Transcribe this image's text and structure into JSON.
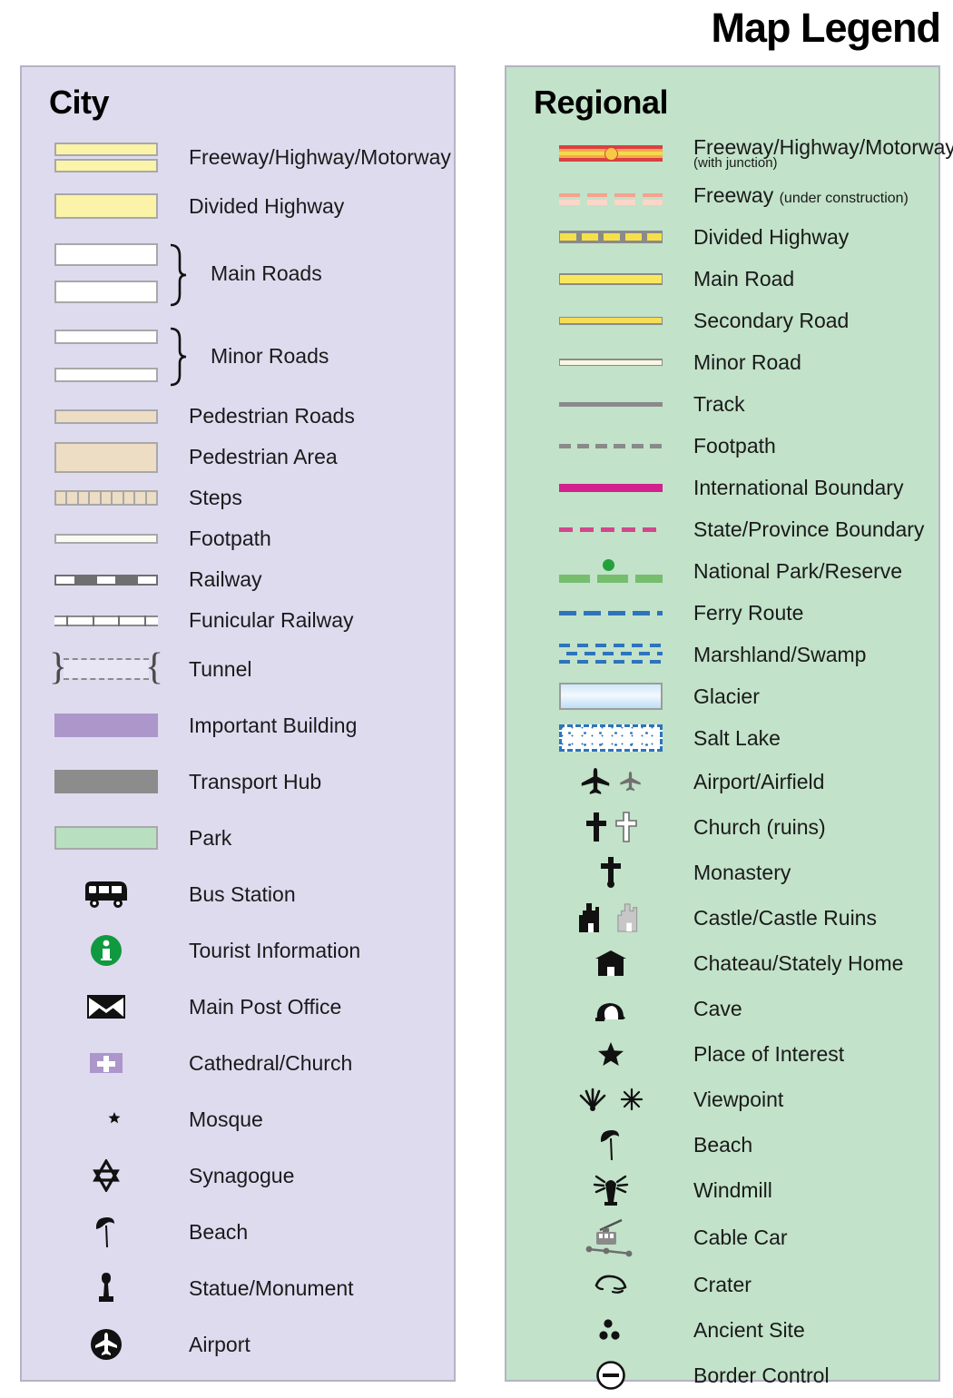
{
  "title": "Map Legend",
  "city": {
    "heading": "City",
    "bg_color": "#dedbef",
    "items": [
      {
        "symbol": "city-freeway-swatch",
        "label": "Freeway/Highway/Motorway"
      },
      {
        "symbol": "city-divided-highway-swatch",
        "label": "Divided Highway"
      },
      {
        "symbol": "city-main-roads-swatch",
        "label": "Main Roads"
      },
      {
        "symbol": "city-minor-roads-swatch",
        "label": "Minor Roads"
      },
      {
        "symbol": "city-pedestrian-road-swatch",
        "label": "Pedestrian Roads"
      },
      {
        "symbol": "city-pedestrian-area-swatch",
        "label": "Pedestrian Area"
      },
      {
        "symbol": "city-steps-swatch",
        "label": "Steps"
      },
      {
        "symbol": "city-footpath-swatch",
        "label": "Footpath"
      },
      {
        "symbol": "city-railway-swatch",
        "label": "Railway"
      },
      {
        "symbol": "city-funicular-swatch",
        "label": "Funicular Railway"
      },
      {
        "symbol": "city-tunnel-swatch",
        "label": "Tunnel"
      },
      {
        "symbol": "city-important-building-swatch",
        "label": "Important Building"
      },
      {
        "symbol": "city-transport-hub-swatch",
        "label": "Transport Hub"
      },
      {
        "symbol": "city-park-swatch",
        "label": "Park"
      },
      {
        "symbol": "bus-icon",
        "label": "Bus Station"
      },
      {
        "symbol": "information-icon",
        "label": "Tourist Information"
      },
      {
        "symbol": "envelope-icon",
        "label": "Main Post Office"
      },
      {
        "symbol": "church-cross-icon",
        "label": "Cathedral/Church"
      },
      {
        "symbol": "crescent-star-icon",
        "label": "Mosque"
      },
      {
        "symbol": "star-of-david-icon",
        "label": "Synagogue"
      },
      {
        "symbol": "beach-umbrella-icon",
        "label": "Beach"
      },
      {
        "symbol": "statue-icon",
        "label": "Statue/Monument"
      },
      {
        "symbol": "airplane-circle-icon",
        "label": "Airport"
      }
    ]
  },
  "regional": {
    "heading": "Regional",
    "bg_color": "#c2e2c9",
    "items": [
      {
        "symbol": "regional-freeway-line",
        "label": "Freeway/Highway/Motorway",
        "sub_line": "(with junction)"
      },
      {
        "symbol": "regional-freeway-uc-line",
        "label": "Freeway ",
        "sub": "(under construction)"
      },
      {
        "symbol": "regional-divided-highway-line",
        "label": "Divided Highway"
      },
      {
        "symbol": "regional-main-road-line",
        "label": "Main Road"
      },
      {
        "symbol": "regional-secondary-road-line",
        "label": "Secondary Road"
      },
      {
        "symbol": "regional-minor-road-line",
        "label": "Minor Road"
      },
      {
        "symbol": "regional-track-line",
        "label": "Track"
      },
      {
        "symbol": "regional-footpath-line",
        "label": "Footpath"
      },
      {
        "symbol": "international-boundary-line",
        "label": "International Boundary"
      },
      {
        "symbol": "state-boundary-line",
        "label": "State/Province Boundary"
      },
      {
        "symbol": "national-park-line",
        "label": "National Park/Reserve"
      },
      {
        "symbol": "ferry-route-line",
        "label": "Ferry Route"
      },
      {
        "symbol": "marshland-swatch",
        "label": "Marshland/Swamp"
      },
      {
        "symbol": "glacier-swatch",
        "label": "Glacier"
      },
      {
        "symbol": "salt-lake-swatch",
        "label": "Salt Lake"
      },
      {
        "symbol": "airplane-pair-icon",
        "label": "Airport/Airfield"
      },
      {
        "symbol": "cross-pair-icon",
        "label": "Church (ruins)"
      },
      {
        "symbol": "monastery-cross-icon",
        "label": "Monastery"
      },
      {
        "symbol": "castle-pair-icon",
        "label": "Castle/Castle Ruins"
      },
      {
        "symbol": "chateau-icon",
        "label": "Chateau/Stately Home"
      },
      {
        "symbol": "cave-icon",
        "label": "Cave"
      },
      {
        "symbol": "star-icon",
        "label": "Place of Interest"
      },
      {
        "symbol": "viewpoint-pair-icon",
        "label": "Viewpoint"
      },
      {
        "symbol": "beach-umbrella-icon",
        "label": "Beach"
      },
      {
        "symbol": "windmill-icon",
        "label": "Windmill"
      },
      {
        "symbol": "cable-car-icon",
        "label": "Cable Car"
      },
      {
        "symbol": "crater-icon",
        "label": "Crater"
      },
      {
        "symbol": "ancient-site-icon",
        "label": "Ancient Site"
      },
      {
        "symbol": "border-control-icon",
        "label": "Border Control"
      }
    ]
  },
  "colors": {
    "city_panel": "#dedbef",
    "regional_panel": "#c2e2c9",
    "highway_yellow": "#faf3a8",
    "freeway_red": "#d94040",
    "freeway_orange": "#f5a84e",
    "junction_yellow": "#f7c846",
    "boundary_magenta": "#d2208c",
    "park_green": "#76bd6e",
    "ferry_blue": "#2d74bd",
    "important_building_purple": "#ad96ca",
    "transport_hub_gray": "#8c8c8c",
    "park_swatch_green": "#b9dfc1",
    "pedestrian_tan": "#ecddc4",
    "info_green": "#1a9641"
  }
}
